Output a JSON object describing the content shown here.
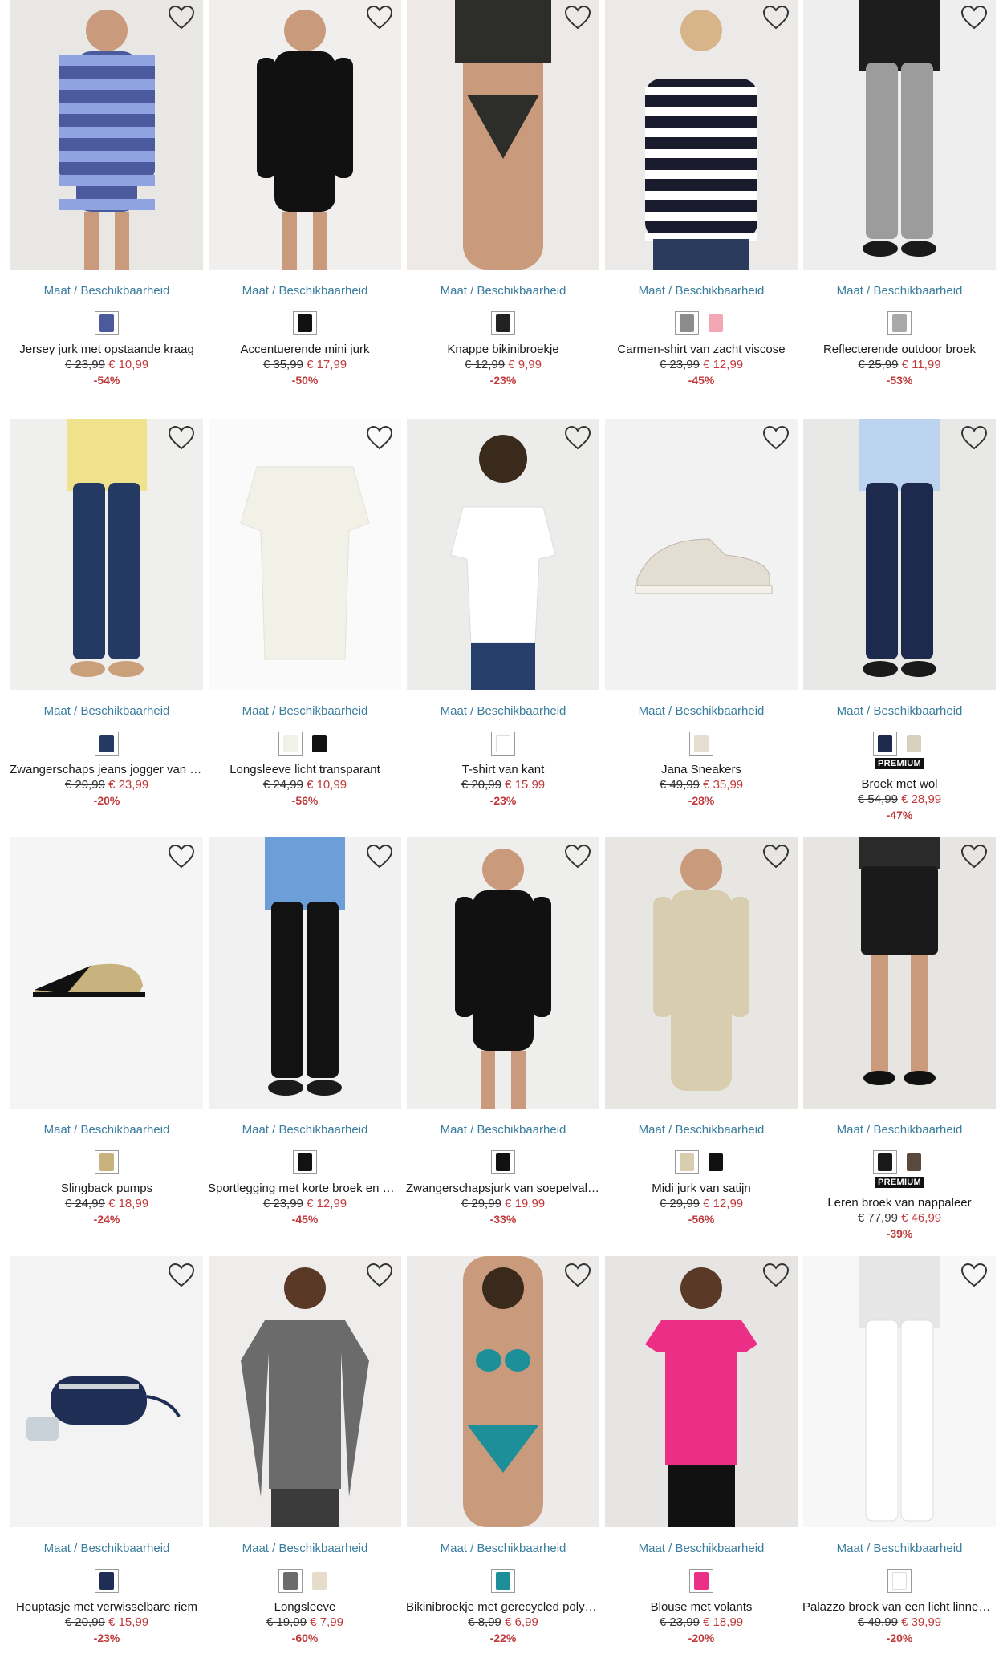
{
  "common": {
    "maat_label": "Maat / Beschikbaarheid",
    "premium_label": "PREMIUM"
  },
  "products": [
    {
      "name": "Jersey jurk met opstaande kraag",
      "old_price": "€ 23,99",
      "new_price": "€ 10,99",
      "discount": "-54%",
      "bg": "#e9e7e4",
      "main": "#4a5a9c",
      "accent": "#8fa3e0",
      "swatches": [
        "#4a5a9c"
      ],
      "premium": false
    },
    {
      "name": "Accentuerende mini jurk",
      "old_price": "€ 35,99",
      "new_price": "€ 17,99",
      "discount": "-50%",
      "bg": "#f0efed",
      "main": "#111111",
      "accent": "#2a2a2a",
      "swatches": [
        "#111111"
      ],
      "premium": false
    },
    {
      "name": "Knappe bikinibroekje",
      "old_price": "€ 12,99",
      "new_price": "€ 9,99",
      "discount": "-23%",
      "bg": "#ece9e6",
      "main": "#2d2d2a",
      "accent": "#d9b39a",
      "swatches": [
        "#222222"
      ],
      "premium": false
    },
    {
      "name": "Carmen-shirt van zacht viscose",
      "old_price": "€ 23,99",
      "new_price": "€ 12,99",
      "discount": "-45%",
      "bg": "#ebeae8",
      "main": "#1b1b2e",
      "accent": "#ffffff",
      "swatches": [
        "#8c8c8c",
        "#f3a7b4"
      ],
      "premium": false
    },
    {
      "name": "Reflecterende outdoor broek",
      "old_price": "€ 25,99",
      "new_price": "€ 11,99",
      "discount": "-53%",
      "bg": "#eeeeee",
      "main": "#9c9c9c",
      "accent": "#2a2a2a",
      "swatches": [
        "#a8a8a8"
      ],
      "premium": false
    },
    {
      "name": "Zwangerschaps jeans jogger van biologisch katoen",
      "old_price": "€ 29,99",
      "new_price": "€ 23,99",
      "discount": "-20%",
      "bg": "#efefed",
      "main": "#243a63",
      "accent": "#f1e28e",
      "swatches": [
        "#243a63"
      ],
      "premium": false
    },
    {
      "name": "Longsleeve licht transparant",
      "old_price": "€ 24,99",
      "new_price": "€ 10,99",
      "discount": "-56%",
      "bg": "#fafafa",
      "main": "#f2f1e8",
      "accent": "#e3e2d8",
      "swatches": [
        "#f2f1e8",
        "#111111"
      ],
      "premium": false
    },
    {
      "name": "T-shirt van kant",
      "old_price": "€ 20,99",
      "new_price": "€ 15,99",
      "discount": "-23%",
      "bg": "#ececea",
      "main": "#ffffff",
      "accent": "#27406b",
      "swatches": [
        "#ffffff"
      ],
      "premium": false
    },
    {
      "name": "Jana Sneakers",
      "old_price": "€ 49,99",
      "new_price": "€ 35,99",
      "discount": "-28%",
      "bg": "#f2f2f2",
      "main": "#e3ddd2",
      "accent": "#bdb6aa",
      "swatches": [
        "#e3ddd2"
      ],
      "premium": false
    },
    {
      "name": "Broek met wol",
      "old_price": "€ 54,99",
      "new_price": "€ 28,99",
      "discount": "-47%",
      "bg": "#e8e8e6",
      "main": "#1d2a4d",
      "accent": "#bcd3f0",
      "swatches": [
        "#1d2a4d",
        "#d8d1bd"
      ],
      "premium": true
    },
    {
      "name": "Slingback pumps",
      "old_price": "€ 24,99",
      "new_price": "€ 18,99",
      "discount": "-24%",
      "bg": "#f5f5f5",
      "main": "#c8b27d",
      "accent": "#111111",
      "swatches": [
        "#c8b27d"
      ],
      "premium": false
    },
    {
      "name": "Sportlegging met korte broek en mesh",
      "old_price": "€ 23,99",
      "new_price": "€ 12,99",
      "discount": "-45%",
      "bg": "#f1f1f1",
      "main": "#121212",
      "accent": "#6c9fd8",
      "swatches": [
        "#121212"
      ],
      "premium": false
    },
    {
      "name": "Zwangerschapsjurk van soepelvallend viscose",
      "old_price": "€ 29,99",
      "new_price": "€ 19,99",
      "discount": "-33%",
      "bg": "#eeeeec",
      "main": "#111111",
      "accent": "#2a2a2a",
      "swatches": [
        "#111111"
      ],
      "premium": false
    },
    {
      "name": "Midi jurk van satijn",
      "old_price": "€ 29,99",
      "new_price": "€ 12,99",
      "discount": "-56%",
      "bg": "#e7e6e3",
      "main": "#d9cdb0",
      "accent": "#c9bb98",
      "swatches": [
        "#d9cdb0",
        "#111111"
      ],
      "premium": false
    },
    {
      "name": "Leren broek van nappaleer",
      "old_price": "€ 77,99",
      "new_price": "€ 46,99",
      "discount": "-39%",
      "bg": "#e7e5e2",
      "main": "#1a1a1a",
      "accent": "#3a3a3a",
      "swatches": [
        "#1a1a1a",
        "#5a4a3e"
      ],
      "premium": true
    },
    {
      "name": "Heuptasje met verwisselbare riem",
      "old_price": "€ 20,99",
      "new_price": "€ 15,99",
      "discount": "-23%",
      "bg": "#f3f3f3",
      "main": "#1f2e55",
      "accent": "#c9d2d8",
      "swatches": [
        "#1f2e55"
      ],
      "premium": false
    },
    {
      "name": "Longsleeve",
      "old_price": "€ 19,99",
      "new_price": "€ 7,99",
      "discount": "-60%",
      "bg": "#eeedeb",
      "main": "#6b6b6b",
      "accent": "#3b3b3b",
      "swatches": [
        "#6b6b6b",
        "#e5dcc9"
      ],
      "premium": false
    },
    {
      "name": "Bikinibroekje met gerecycled polyamide",
      "old_price": "€ 8,99",
      "new_price": "€ 6,99",
      "discount": "-22%",
      "bg": "#ecebea",
      "main": "#1c8f98",
      "accent": "#d9a98c",
      "swatches": [
        "#1c8f98"
      ],
      "premium": false
    },
    {
      "name": "Blouse met volants",
      "old_price": "€ 23,99",
      "new_price": "€ 18,99",
      "discount": "-20%",
      "bg": "#e7e5e3",
      "main": "#ec2f86",
      "accent": "#111111",
      "swatches": [
        "#ec2f86"
      ],
      "premium": false
    },
    {
      "name": "Palazzo broek van een licht linnenmix",
      "old_price": "€ 49,99",
      "new_price": "€ 39,99",
      "discount": "-20%",
      "bg": "#f7f7f7",
      "main": "#ffffff",
      "accent": "#e6e6e6",
      "swatches": [
        "#ffffff"
      ],
      "premium": false
    }
  ]
}
